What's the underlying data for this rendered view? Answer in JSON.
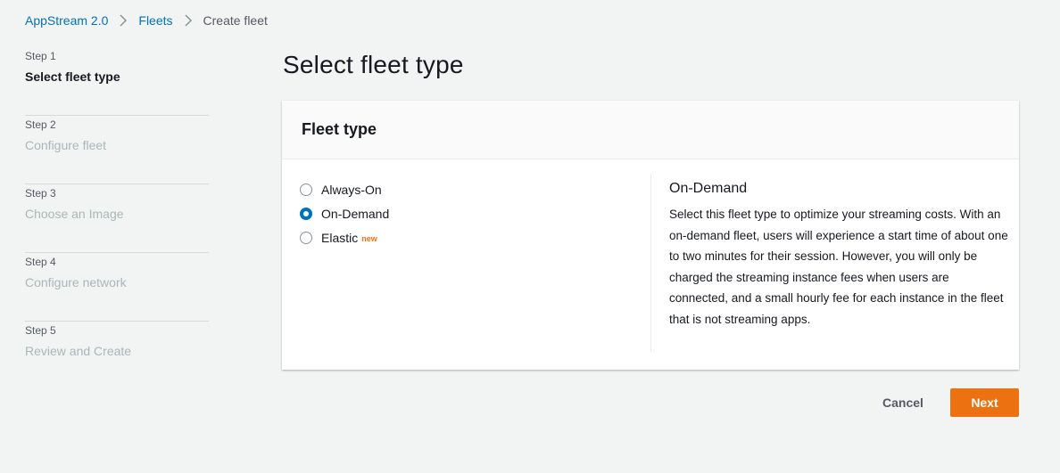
{
  "breadcrumb": {
    "items": [
      {
        "label": "AppStream 2.0"
      },
      {
        "label": "Fleets"
      }
    ],
    "current": "Create fleet"
  },
  "steps": [
    {
      "num": "Step 1",
      "title": "Select fleet type",
      "active": true
    },
    {
      "num": "Step 2",
      "title": "Configure fleet",
      "active": false
    },
    {
      "num": "Step 3",
      "title": "Choose an Image",
      "active": false
    },
    {
      "num": "Step 4",
      "title": "Configure network",
      "active": false
    },
    {
      "num": "Step 5",
      "title": "Review and Create",
      "active": false
    }
  ],
  "page_title": "Select fleet type",
  "panel": {
    "header": "Fleet type",
    "options": [
      {
        "label": "Always-On",
        "selected": false
      },
      {
        "label": "On-Demand",
        "selected": true
      },
      {
        "label": "Elastic",
        "badge": "new",
        "selected": false
      }
    ],
    "description": {
      "title": "On-Demand",
      "text": "Select this fleet type to optimize your streaming costs. With an on-demand fleet, users will experience a start time of about one to two minutes for their session. However, you will only be charged the streaming instance fees when users are connected, and a small hourly fee for each instance in the fleet that is not streaming apps."
    }
  },
  "actions": {
    "cancel": "Cancel",
    "next": "Next"
  },
  "colors": {
    "accent": "#ec7211",
    "link": "#0073bb",
    "background": "#f2f3f3"
  }
}
